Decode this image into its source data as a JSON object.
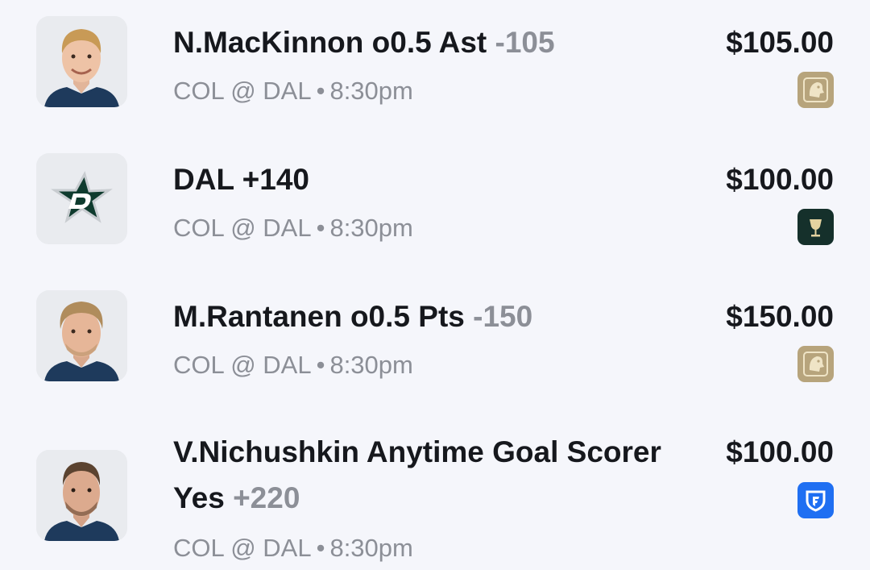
{
  "bets": [
    {
      "title": "N.MacKinnon o0.5 Ast",
      "title_line2": "",
      "odds": "-105",
      "matchup": "COL @ DAL",
      "time": "8:30pm",
      "amount": "$105.00",
      "thumb_icon": "player-headshot-icon",
      "book_icon": "lion-crest-book-icon",
      "book_color": "#b7a47c"
    },
    {
      "title": "DAL +140",
      "title_line2": "",
      "odds": "",
      "matchup": "COL @ DAL",
      "time": "8:30pm",
      "amount": "$100.00",
      "thumb_icon": "dallas-stars-logo-icon",
      "book_icon": "trophy-book-icon",
      "book_color": "#15302b"
    },
    {
      "title": "M.Rantanen o0.5 Pts",
      "title_line2": "",
      "odds": "-150",
      "matchup": "COL @ DAL",
      "time": "8:30pm",
      "amount": "$150.00",
      "thumb_icon": "player-headshot-icon",
      "book_icon": "lion-crest-book-icon",
      "book_color": "#b7a47c"
    },
    {
      "title": "V.Nichushkin Anytime Goal Scorer",
      "title_line2": "Yes",
      "odds": "+220",
      "matchup": "COL @ DAL",
      "time": "8:30pm",
      "amount": "$100.00",
      "thumb_icon": "player-headshot-icon",
      "book_icon": "shield-book-icon",
      "book_color": "#1f6ff2"
    }
  ],
  "separator": "•",
  "colors": {
    "background": "#f5f6fb",
    "text_primary": "#16181d",
    "text_secondary": "#8c8f97",
    "thumb_bg": "#e9ebef",
    "jersey": "#1e3a5c"
  }
}
